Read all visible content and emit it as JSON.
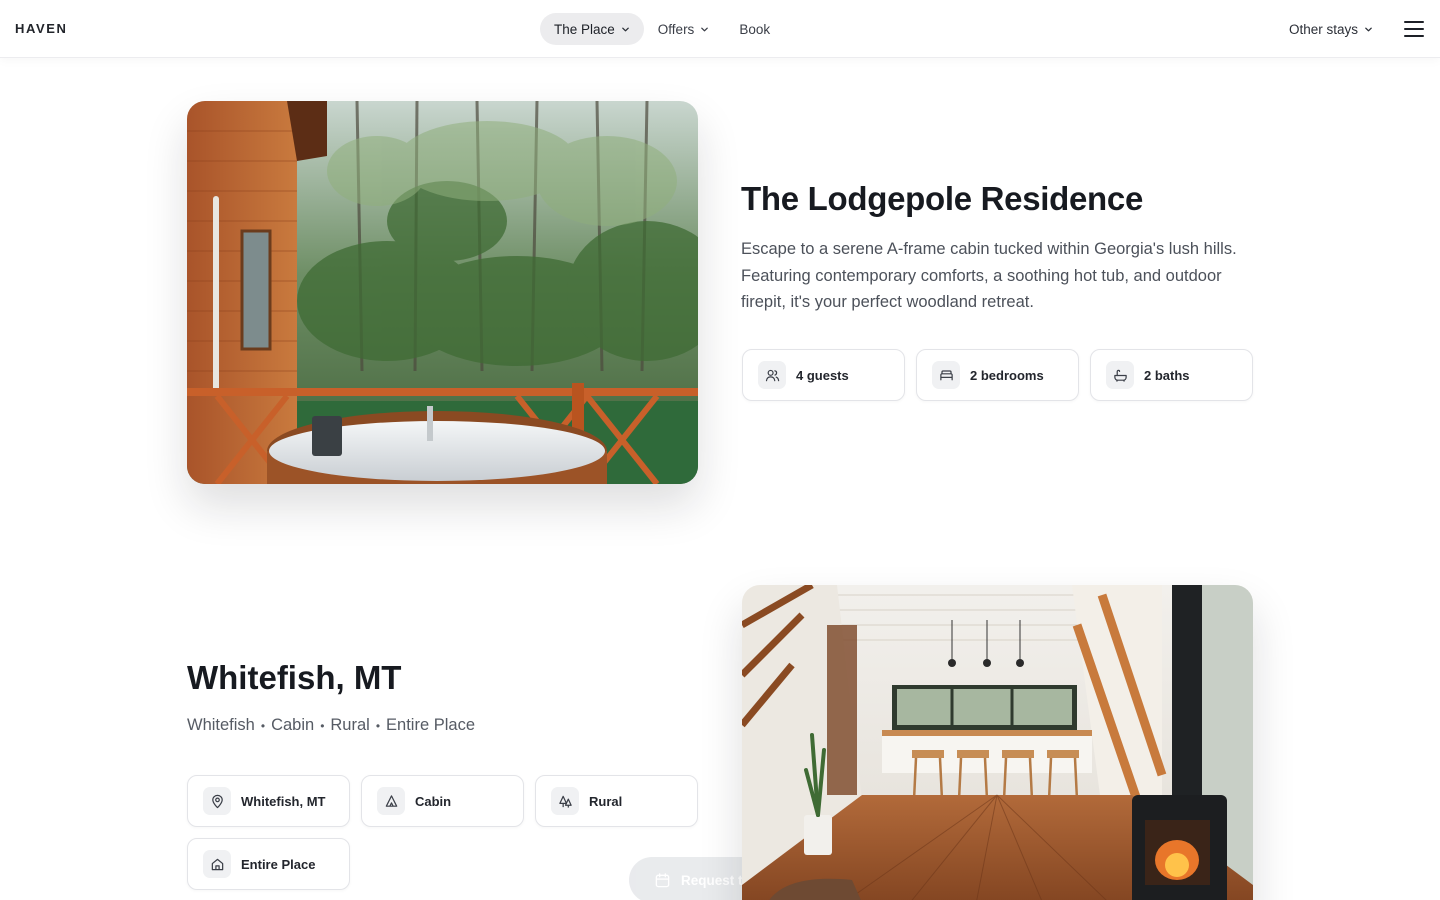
{
  "header": {
    "logo": "HAVEN",
    "nav": [
      {
        "label": "The Place",
        "has_dropdown": true,
        "active": true
      },
      {
        "label": "Offers",
        "has_dropdown": true,
        "active": false
      },
      {
        "label": "Book",
        "has_dropdown": false,
        "active": false
      }
    ],
    "other_stays": "Other stays",
    "menu_icon": "hamburger-menu-icon"
  },
  "listing": {
    "title": "The Lodgepole Residence",
    "description": "Escape to a serene A-frame cabin tucked within Georgia's lush hills. Featuring contemporary comforts, a soothing hot tub, and outdoor firepit, it's your perfect woodland retreat.",
    "image_alt": "Wooden deck with round hot tub in front of a forest",
    "features": [
      {
        "icon": "guests-icon",
        "label": "4 guests"
      },
      {
        "icon": "bed-icon",
        "label": "2 bedrooms"
      },
      {
        "icon": "bath-icon",
        "label": "2 baths"
      }
    ]
  },
  "location": {
    "title": "Whitefish, MT",
    "tags": [
      "Whitefish",
      "Cabin",
      "Rural",
      "Entire Place"
    ],
    "separator": "•",
    "image_alt": "Cabin interior with kitchen bar stools and wood stove",
    "chips": [
      {
        "icon": "map-pin-icon",
        "label": "Whitefish, MT"
      },
      {
        "icon": "tent-icon",
        "label": "Cabin"
      },
      {
        "icon": "trees-icon",
        "label": "Rural"
      },
      {
        "icon": "home-icon",
        "label": "Entire Place"
      }
    ]
  },
  "cta": {
    "label": "Request to Book",
    "icon": "calendar-icon"
  },
  "colors": {
    "text": "#171a20",
    "muted": "#4c515a",
    "chip_border": "#e3e4e8",
    "nav_active_bg": "#ececee"
  }
}
